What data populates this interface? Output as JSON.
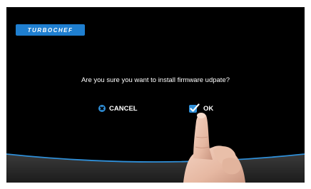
{
  "brand": {
    "logo_text": "TURBOCHEF",
    "color": "#1f7fd0"
  },
  "dialog": {
    "question": "Are you sure you want to install firmware udpate?",
    "cancel_label": "CANCEL",
    "ok_label": "OK"
  },
  "colors": {
    "screen_bg": "#000000",
    "accent": "#2f8fd8",
    "footer": "#2a2a2a",
    "text": "#ffffff"
  },
  "icons": {
    "cancel": "x-circle-icon",
    "ok": "checkmark-box-icon"
  }
}
